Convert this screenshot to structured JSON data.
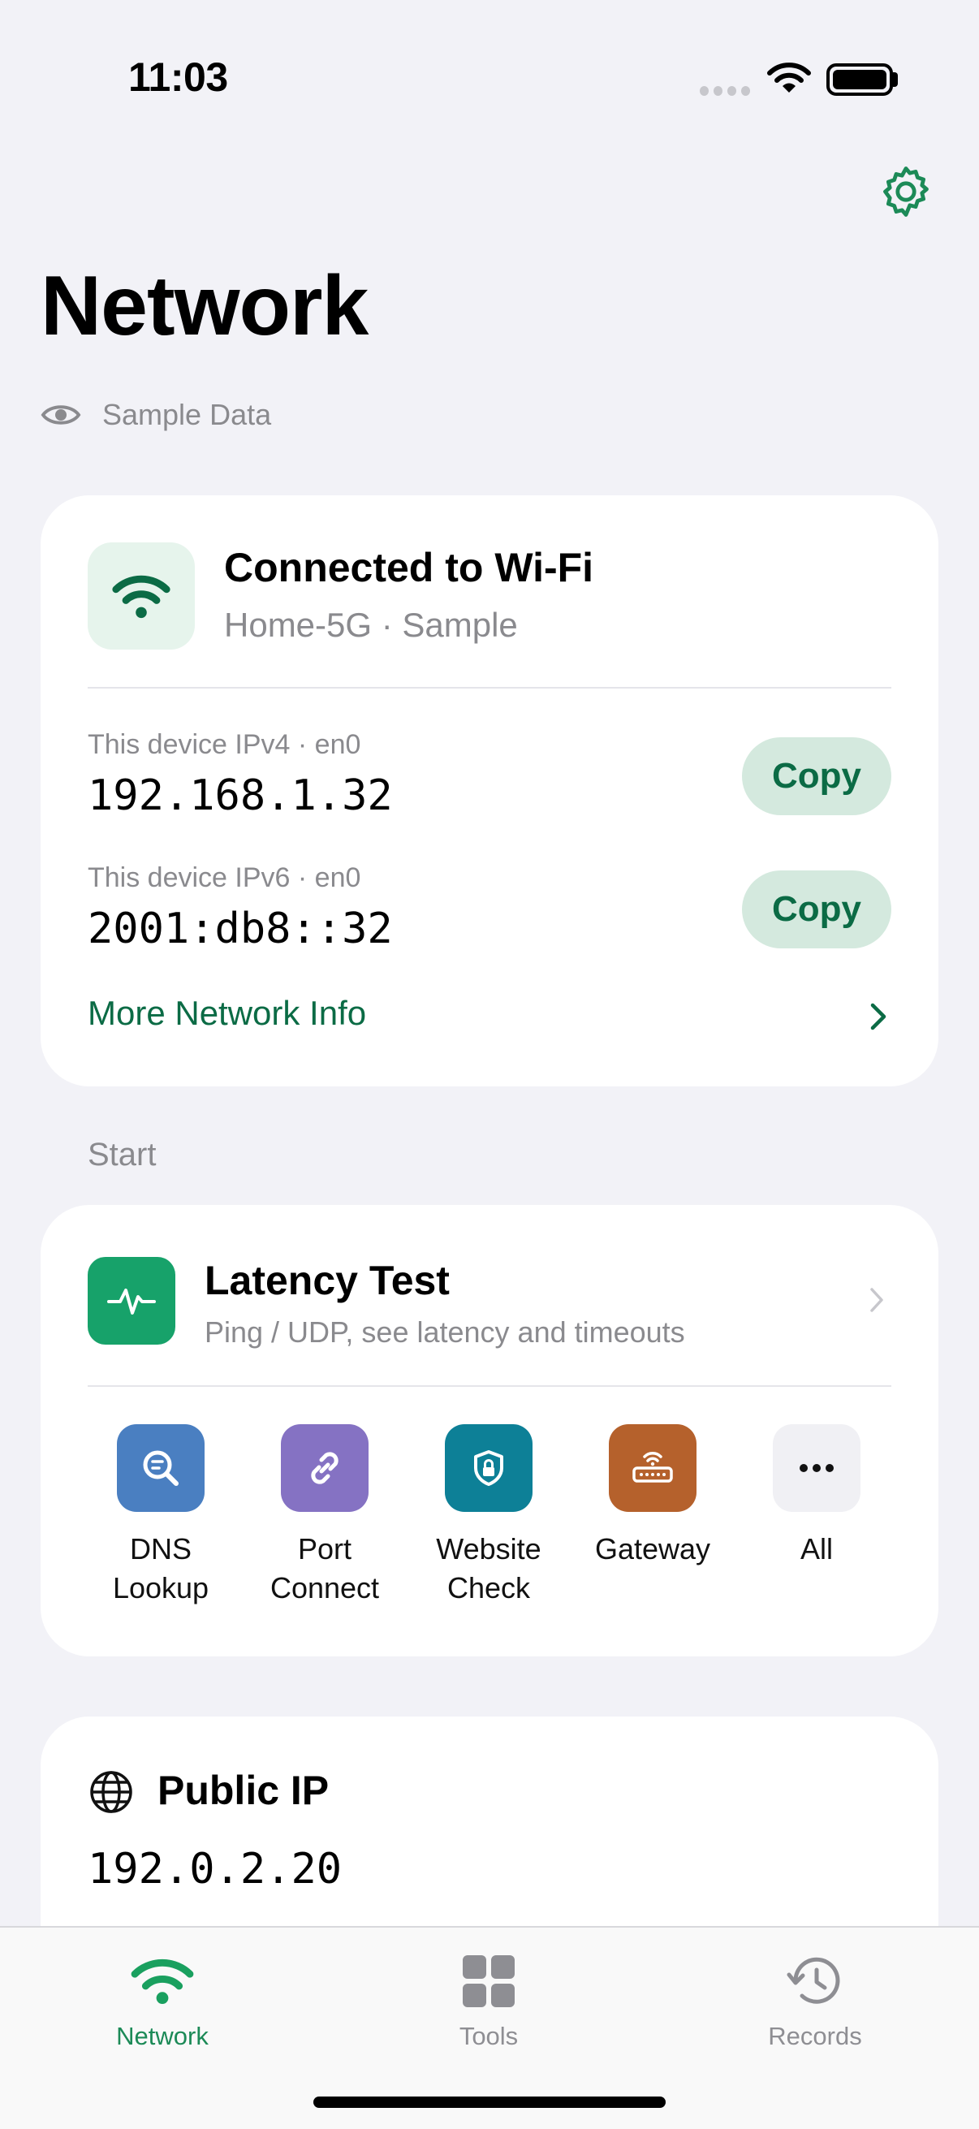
{
  "status_bar": {
    "time": "11:03"
  },
  "header": {
    "title": "Network",
    "sample_label": "Sample Data"
  },
  "connection_card": {
    "title": "Connected to Wi-Fi",
    "subtitle": "Home-5G · Sample",
    "ipv4_label": "This device IPv4 · en0",
    "ipv4_value": "192.168.1.32",
    "ipv6_label": "This device IPv6 · en0",
    "ipv6_value": "2001:db8::32",
    "copy_label": "Copy",
    "more_info_label": "More Network Info"
  },
  "start_section": {
    "label": "Start",
    "latency": {
      "title": "Latency Test",
      "subtitle": "Ping / UDP, see latency and timeouts"
    },
    "tools": [
      {
        "label": "DNS\nLookup",
        "icon": "magnifier-icon",
        "color": "#4a7fc1"
      },
      {
        "label": "Port\nConnect",
        "icon": "link-icon",
        "color": "#8572c3"
      },
      {
        "label": "Website\nCheck",
        "icon": "shield-lock-icon",
        "color": "#0d8097"
      },
      {
        "label": "Gateway",
        "icon": "router-icon",
        "color": "#b5612c"
      },
      {
        "label": "All",
        "icon": "more-icon",
        "color": "#f0f0f4"
      }
    ]
  },
  "public_ip_card": {
    "title": "Public IP",
    "value": "192.0.2.20"
  },
  "tab_bar": {
    "tabs": [
      {
        "label": "Network",
        "active": true
      },
      {
        "label": "Tools",
        "active": false
      },
      {
        "label": "Records",
        "active": false
      }
    ]
  },
  "colors": {
    "accent": "#0b6b45",
    "accent_light": "#1aa05f",
    "background": "#f2f2f7"
  }
}
